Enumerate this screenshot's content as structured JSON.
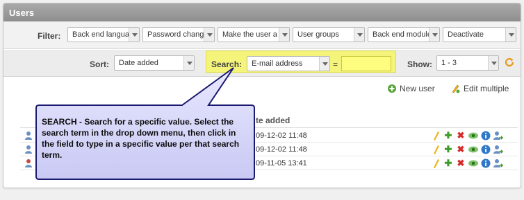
{
  "panel": {
    "title": "Users"
  },
  "filter": {
    "label": "Filter:",
    "selects": [
      "Back end langua",
      "Password chang",
      "Make the user a",
      "User groups",
      "Back end module",
      "Deactivate"
    ]
  },
  "sort": {
    "label": "Sort:",
    "value": "Date added",
    "search_label": "Search:",
    "search_field": "E-mail address",
    "equals": "=",
    "search_value": "",
    "show_label": "Show:",
    "show_value": "1 - 3"
  },
  "actions": {
    "new_user": "New user",
    "edit_multiple": "Edit multiple"
  },
  "table": {
    "date_header": "te added",
    "rows": [
      {
        "date": "09-12-02 11:48"
      },
      {
        "date": "09-12-02 11:48"
      },
      {
        "date": "09-11-05 13:41"
      }
    ]
  },
  "callout": {
    "text": "SEARCH - Search for a specific value.  Select the search term in the drop down menu, then click in the field to type in a specific value per that search term."
  },
  "colors": {
    "highlight": "#f4f37a",
    "callout_fill": "#dcdcff",
    "callout_border": "#1a1a6e",
    "header": "#9a9a9a"
  }
}
